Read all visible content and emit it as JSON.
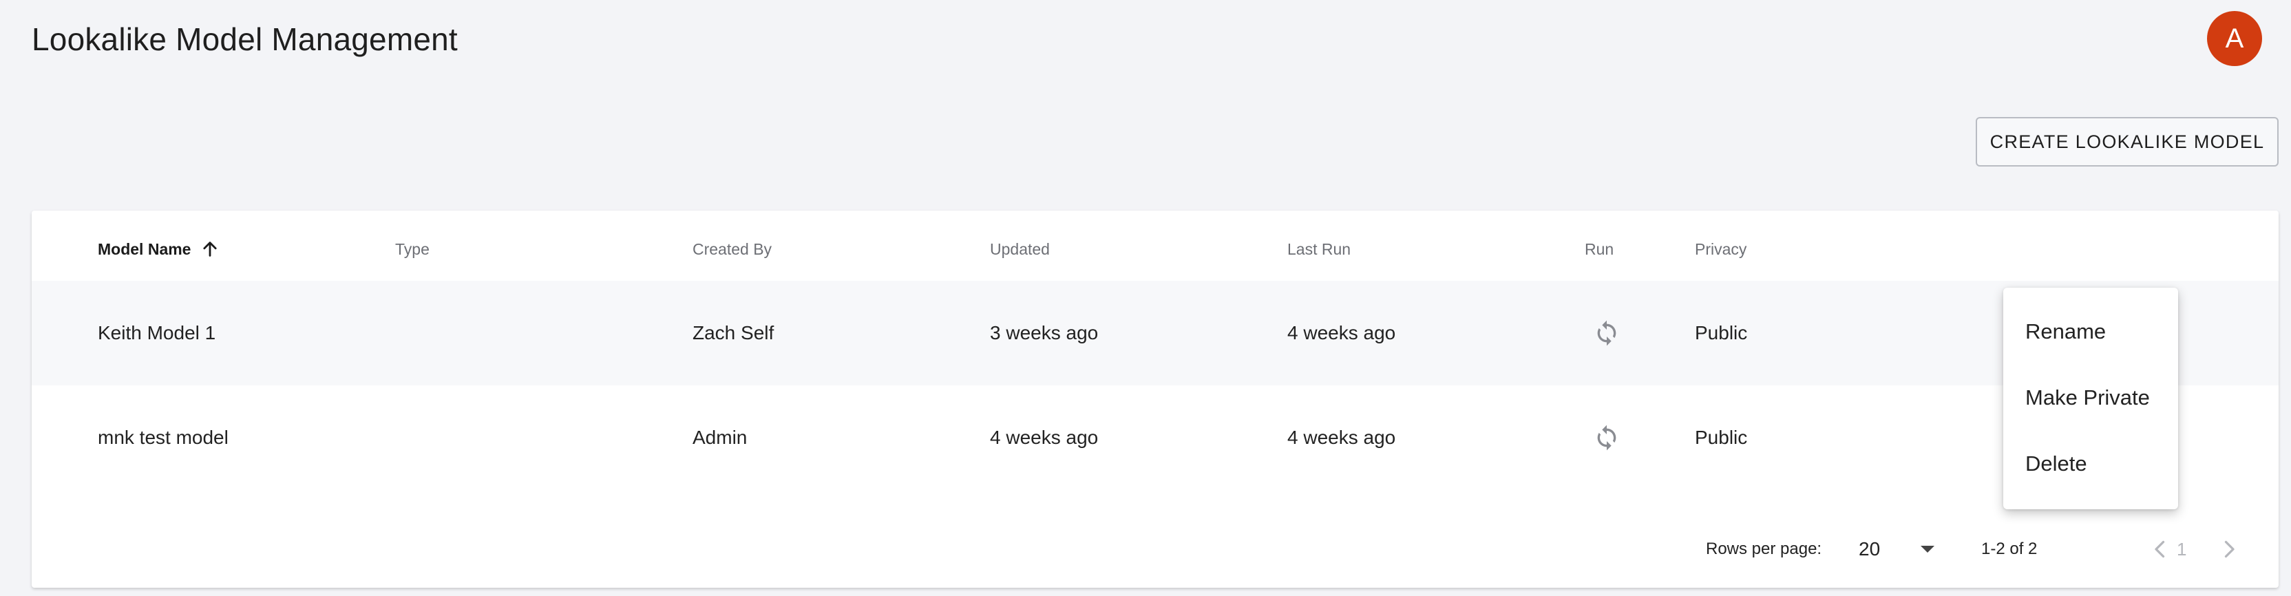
{
  "header": {
    "title": "Lookalike Model Management",
    "avatar_letter": "A"
  },
  "actions": {
    "create_label": "CREATE LOOKALIKE MODEL"
  },
  "table": {
    "columns": [
      "Model Name",
      "Type",
      "Created By",
      "Updated",
      "Last Run",
      "Run",
      "Privacy"
    ],
    "sort": {
      "column": "Model Name",
      "direction": "ascending"
    },
    "rows": [
      {
        "model_name": "Keith Model 1",
        "type": "",
        "created_by": "Zach Self",
        "updated": "3 weeks ago",
        "last_run": "4 weeks ago",
        "run_icon": "refresh-icon",
        "privacy": "Public"
      },
      {
        "model_name": "mnk test model",
        "type": "",
        "created_by": "Admin",
        "updated": "4 weeks ago",
        "last_run": "4 weeks ago",
        "run_icon": "refresh-icon",
        "privacy": "Public"
      }
    ]
  },
  "pagination": {
    "rows_per_page_label": "Rows per page:",
    "rows_per_page_value": "20",
    "range_label": "1-2 of 2",
    "current_page": "1"
  },
  "context_menu": {
    "items": [
      "Rename",
      "Make Private",
      "Delete"
    ]
  },
  "colors": {
    "avatar_bg": "#d23c10",
    "page_bg": "#f3f4f7",
    "row_highlight": "#f7f8fa"
  }
}
